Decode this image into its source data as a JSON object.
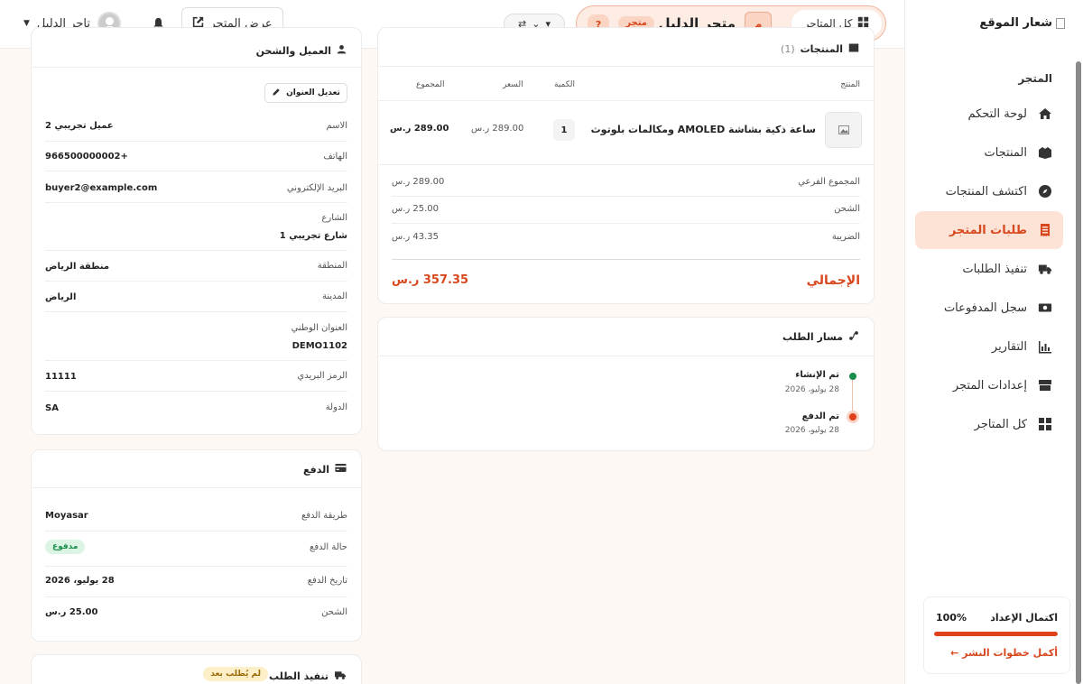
{
  "sidebar": {
    "logo_text": "شعار الموقع",
    "section_title": "المتجر",
    "items": [
      {
        "label": "لوحة التحكم",
        "icon": "home-icon"
      },
      {
        "label": "المنتجات",
        "icon": "boxes-icon"
      },
      {
        "label": "اكتشف المنتجات",
        "icon": "compass-icon"
      },
      {
        "label": "طلبات المتجر",
        "icon": "receipt-icon",
        "active": true
      },
      {
        "label": "تنفيذ الطلبات",
        "icon": "truck-icon"
      },
      {
        "label": "سجل المدفوعات",
        "icon": "money-icon"
      },
      {
        "label": "التقارير",
        "icon": "chart-icon"
      },
      {
        "label": "إعدادات المتجر",
        "icon": "store-icon"
      },
      {
        "label": "كل المتاجر",
        "icon": "grid-icon"
      }
    ],
    "setup": {
      "title": "اكتمال الإعداد",
      "percent_text": "100%",
      "progress": 1.0,
      "link": "أكمل خطوات النشر ←"
    }
  },
  "topbar": {
    "all_stores": "كل المتاجر",
    "store_initial": "م",
    "store_name": "متجر الدليل",
    "store_badge": "متجر",
    "help": "?",
    "view_store": "عرض المتجر",
    "user_name": "تاجر الدليل"
  },
  "products": {
    "title": "المنتجات",
    "count": "(1)",
    "headers": {
      "product": "المنتج",
      "qty": "الكمية",
      "price": "السعر",
      "total": "المجموع"
    },
    "item": {
      "name": "ساعة ذكية بشاشة AMOLED ومكالمات بلوتوث",
      "qty": "1",
      "price": "289.00 ر.س",
      "total": "289.00 ر.س"
    },
    "summary": [
      {
        "label": "المجموع الفرعي",
        "value": "289.00 ر.س"
      },
      {
        "label": "الشحن",
        "value": "25.00 ر.س"
      },
      {
        "label": "الضريبة",
        "value": "43.35 ر.س"
      }
    ],
    "grand_label": "الإجمالي",
    "grand_value": "357.35 ر.س"
  },
  "timeline": {
    "title": "مسار الطلب",
    "events": [
      {
        "title": "تم الإنشاء",
        "date": "28 يوليو، 2026",
        "color": "#1a8d4d"
      },
      {
        "title": "تم الدفع",
        "date": "28 يوليو، 2026",
        "color": "#e0401a"
      }
    ]
  },
  "customer": {
    "title": "العميل والشحن",
    "edit_address": "تعديل العنوان",
    "rows": {
      "name_label": "الاسم",
      "name": "عميل تجريبي 2",
      "phone_label": "الهاتف",
      "phone": "+966500000002",
      "email_label": "البريد الإلكتروني",
      "email": "buyer2@example.com",
      "street_label": "الشارع",
      "street": "شارع تجريبي 1",
      "region_label": "المنطقة",
      "region": "منطقة الرياض",
      "city_label": "المدينة",
      "city": "الرياض",
      "national_label": "العنوان الوطني",
      "national": "DEMO1102",
      "postal_label": "الرمز البريدي",
      "postal": "11111",
      "country_label": "الدولة",
      "country": "SA"
    }
  },
  "payment": {
    "title": "الدفع",
    "method_label": "طريقة الدفع",
    "method": "Moyasar",
    "status_label": "حالة الدفع",
    "status": "مدفوع",
    "date_label": "تاريخ الدفع",
    "date": "28 يوليو، 2026",
    "shipping_label": "الشحن",
    "shipping": "25.00 ر.س"
  },
  "fulfillment": {
    "title": "تنفيذ الطلب",
    "badge": "لم يُطلب بعد"
  }
}
